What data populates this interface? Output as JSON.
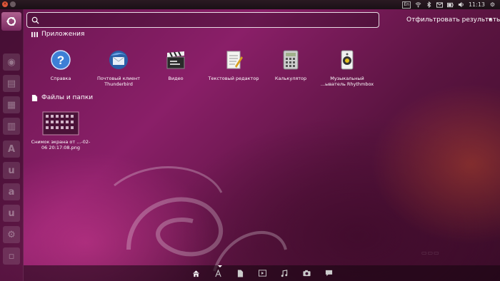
{
  "panel": {
    "keyboard_layout": "En",
    "time": "11:13"
  },
  "search": {
    "value": "",
    "placeholder": ""
  },
  "filter": {
    "label": "Отфильтровать результаты",
    "arrow": "▾"
  },
  "categories": [
    {
      "title": "Приложения",
      "items": [
        {
          "label": "Справка",
          "icon": "help-icon"
        },
        {
          "label": "Почтовый клиент Thunderbird",
          "icon": "thunderbird-icon"
        },
        {
          "label": "Видео",
          "icon": "video-clapper-icon"
        },
        {
          "label": "Текстовый редактор",
          "icon": "text-editor-icon"
        },
        {
          "label": "Калькулятор",
          "icon": "calculator-icon"
        },
        {
          "label": "Музыкальный ...ыватель Rhythmbox",
          "icon": "rhythmbox-icon"
        }
      ]
    },
    {
      "title": "Файлы и папки",
      "items": [
        {
          "label": "Снимок экрана от ...-02-06 20:17:08.png",
          "icon": "screenshot-thumbnail-icon"
        }
      ]
    }
  ],
  "lenses": [
    "home-lens-icon",
    "applications-lens-icon",
    "files-lens-icon",
    "video-lens-icon",
    "music-lens-icon",
    "photos-lens-icon",
    "social-lens-icon"
  ],
  "colors": {
    "accent": "#8a1f68",
    "panel": "#1a1016"
  }
}
